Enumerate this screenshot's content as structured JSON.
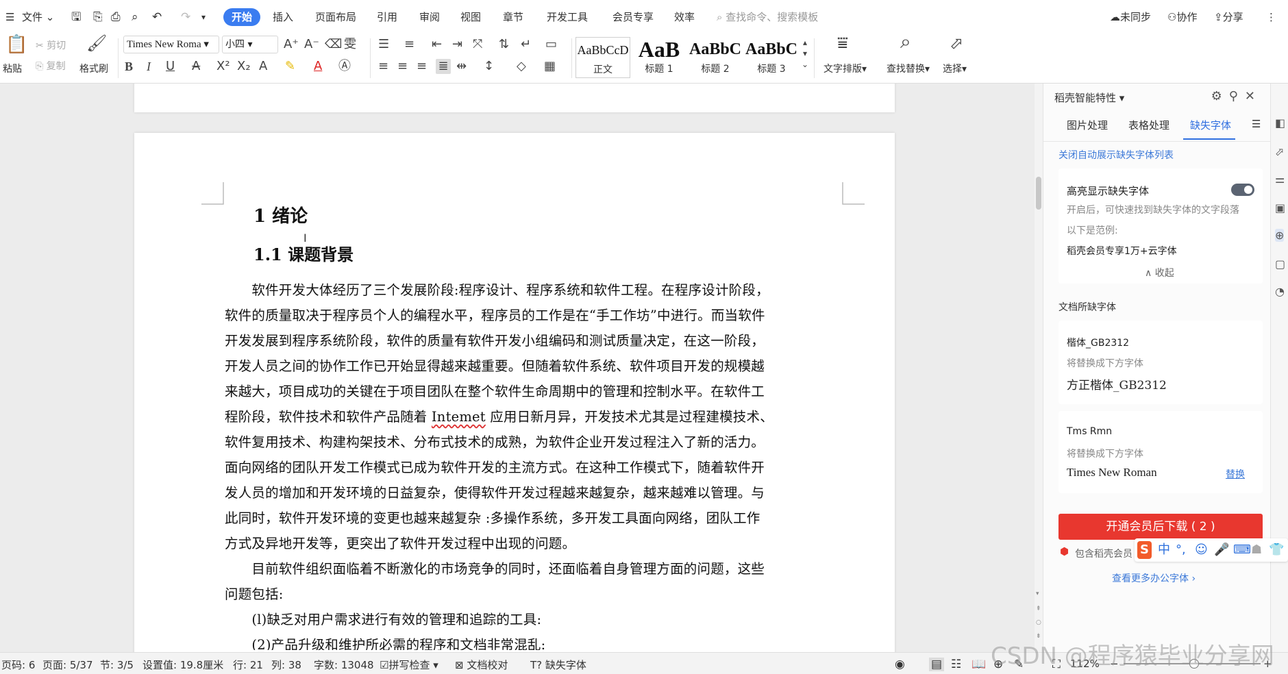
{
  "menubar": {
    "file": "文件",
    "tabs": [
      "开始",
      "插入",
      "页面布局",
      "引用",
      "审阅",
      "视图",
      "章节",
      "开发工具",
      "会员专享",
      "效率"
    ],
    "search_placeholder": "查找命令、搜索模板",
    "right": {
      "sync": "未同步",
      "collab": "协作",
      "share": "分享"
    }
  },
  "ribbon": {
    "paste": "粘贴",
    "cut": "剪切",
    "copy": "复制",
    "format_painter": "格式刷",
    "font_name": "Times New Roma",
    "font_size": "小四",
    "styles": [
      {
        "sample": "AaBbCcD",
        "name": "正文"
      },
      {
        "sample": "AaB",
        "name": "标题 1"
      },
      {
        "sample": "AaBbC",
        "name": "标题 2"
      },
      {
        "sample": "AaBbC",
        "name": "标题 3"
      }
    ],
    "text_layout": "文字排版",
    "find_replace": "查找替换",
    "select": "选择"
  },
  "document": {
    "heading1": "1   绪论",
    "heading2": "1.1   课题背景",
    "para1": [
      "　　软件开发大体经历了三个发展阶段:程序设计、程序系统和软件工程。在程序设计阶段，",
      "软件的质量取决于程序员个人的编程水平，程序员的工作是在“手工作坊”中进行。而当软件",
      "开发发展到程序系统阶段，软件的质量有软件开发小组编码和测试质量决定，在这一阶段，",
      "开发人员之间的协作工作已开始显得越来越重要。但随着软件系统、软件项目开发的规模越",
      "来越大，项目成功的关键在于项目团队在整个软件生命周期中的管理和控制水平。在软件工",
      "程阶段，软件技术和软件产品随着 ",
      "软件复用技术、构建构架技术、分布式技术的成熟，为软件企业开发过程注入了新的活力。",
      "面向网络的团队开发工作模式已成为软件开发的主流方式。在这种工作模式下，随着软件开",
      "发人员的增加和开发环境的日益复杂，使得软件开发过程越来越复杂，越来越难以管理。与",
      "此同时，软件开发环境的变更也越来越复杂 :多操作系统，多开发工具面向网络，团队工作",
      "方式及异地开发等，更突出了软件开发过程中出现的问题。"
    ],
    "para1_line6_word": "Intemet",
    "para1_line6_tail": " 应用日新月异，开发技术尤其是过程建模技术、",
    "para2": [
      "　　目前软件组织面临着不断激化的市场竞争的同时，还面临着自身管理方面的问题，这些",
      "问题包括:"
    ],
    "item1": "　　(l)缺乏对用户需求进行有效的管理和追踪的工具:",
    "item2": "　　(2)产品升级和维护所必需的程序和文档非常混乱:"
  },
  "panel": {
    "title": "稻壳智能特性",
    "tabs": [
      "图片处理",
      "表格处理",
      "缺失字体"
    ],
    "close_auto_link": "关闭自动展示缺失字体列表",
    "highlight": {
      "title": "高亮显示缺失字体",
      "desc": "开启后，可快速找到缺失字体的文字段落",
      "example_label": "以下是范例:",
      "example_value": "稻壳会员专享1万+云字体",
      "collapse": "收起"
    },
    "missing_label": "文档所缺字体",
    "fonts": [
      {
        "name": "楷体_GB2312",
        "hint": "将替换成下方字体",
        "replacement": "方正楷体_GB2312",
        "action": ""
      },
      {
        "name": "Tms Rmn",
        "hint": "将替换成下方字体",
        "replacement": "Times New Roman",
        "action": "替换"
      }
    ],
    "download_button": "开通会员后下载 ( 2 )",
    "include_text": "包含稻壳会员",
    "more_link": "查看更多办公字体 ›"
  },
  "ime": {
    "zh": "中"
  },
  "status": {
    "page_no": "页码: 6",
    "page": "页面: 5/37",
    "section": "节: 3/5",
    "setting": "设置值: 19.8厘米",
    "row": "行: 21",
    "col": "列: 38",
    "words": "字数: 13048",
    "spell": "拼写检查",
    "proof": "文档校对",
    "missing_font": "缺失字体",
    "zoom": "112%"
  },
  "watermark": "CSDN @程序猿毕业分享网",
  "colors": {
    "accent": "#3a7cf0",
    "download": "#e8372f",
    "link": "#3b78d8"
  }
}
